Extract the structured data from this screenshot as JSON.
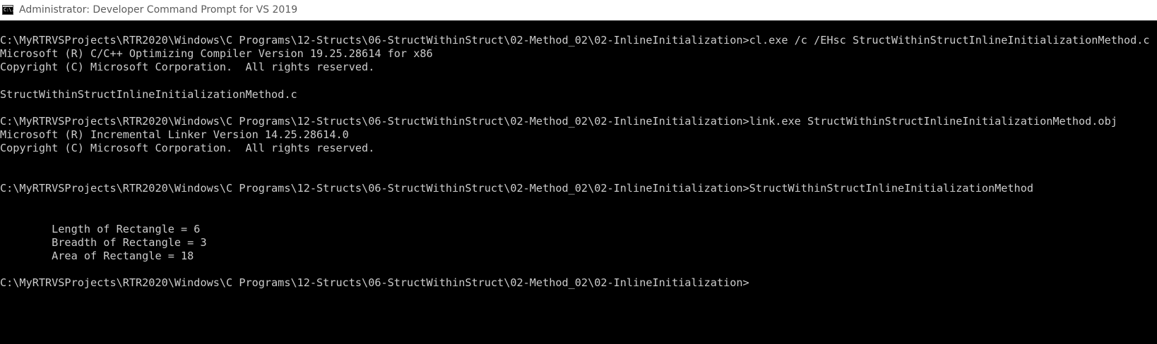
{
  "window": {
    "title": "Administrator: Developer Command Prompt for VS 2019",
    "icon": "cmd-app-icon",
    "icon_glyph": "C:\\."
  },
  "console": {
    "lines": [
      "",
      "C:\\MyRTRVSProjects\\RTR2020\\Windows\\C Programs\\12-Structs\\06-StructWithinStruct\\02-Method_02\\02-InlineInitialization>cl.exe /c /EHsc StructWithinStructInlineInitializationMethod.c",
      "Microsoft (R) C/C++ Optimizing Compiler Version 19.25.28614 for x86",
      "Copyright (C) Microsoft Corporation.  All rights reserved.",
      "",
      "StructWithinStructInlineInitializationMethod.c",
      "",
      "C:\\MyRTRVSProjects\\RTR2020\\Windows\\C Programs\\12-Structs\\06-StructWithinStruct\\02-Method_02\\02-InlineInitialization>link.exe StructWithinStructInlineInitializationMethod.obj",
      "Microsoft (R) Incremental Linker Version 14.25.28614.0",
      "Copyright (C) Microsoft Corporation.  All rights reserved.",
      "",
      "",
      "C:\\MyRTRVSProjects\\RTR2020\\Windows\\C Programs\\12-Structs\\06-StructWithinStruct\\02-Method_02\\02-InlineInitialization>StructWithinStructInlineInitializationMethod",
      "",
      "",
      "        Length of Rectangle = 6",
      "        Breadth of Rectangle = 3",
      "        Area of Rectangle = 18",
      "",
      "C:\\MyRTRVSProjects\\RTR2020\\Windows\\C Programs\\12-Structs\\06-StructWithinStruct\\02-Method_02\\02-InlineInitialization>"
    ]
  }
}
